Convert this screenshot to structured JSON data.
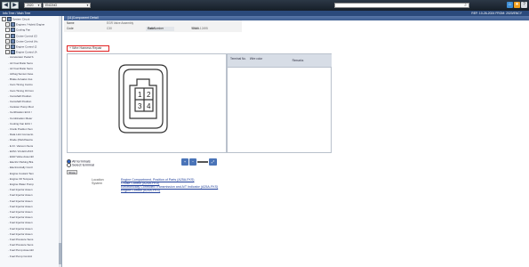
{
  "toolbar": {
    "nav_back": "◀",
    "nav_forward": "▶",
    "year": "2020",
    "model": "ENCINO",
    "search_value": "",
    "bg_color": "#1d2631"
  },
  "subbar": {
    "left": "Info Tree / Main Tree",
    "right": "REF: 10-26-2024 FROM: 2020/ENCY"
  },
  "tree": {
    "items": [
      {
        "label": "System Circuit",
        "kind": "root"
      },
      {
        "label": "Engines / Hybrid Engine",
        "kind": "folder"
      },
      {
        "label": "Cooling Fan",
        "kind": "folder"
      },
      {
        "label": "Cruise Control (Cl",
        "kind": "folder"
      },
      {
        "label": "Cruise Control (Ac",
        "kind": "folder"
      },
      {
        "label": "Engine Control (2",
        "kind": "folder"
      },
      {
        "label": "Engine Control (A",
        "kind": "folder"
      },
      {
        "label": "Accelerator Pedal S",
        "kind": "leaf"
      },
      {
        "label": "Air Fuel Ratio Sens",
        "kind": "leaf"
      },
      {
        "label": "Air Fuel Ratio Sens",
        "kind": "leaf"
      },
      {
        "label": "Airbag Sensor Asse",
        "kind": "leaf"
      },
      {
        "label": "Brake Actuator Ass",
        "kind": "leaf"
      },
      {
        "label": "Cam Timing Contro",
        "kind": "leaf"
      },
      {
        "label": "Cam Timing Oil Con",
        "kind": "leaf"
      },
      {
        "label": "Camshaft Position",
        "kind": "leaf"
      },
      {
        "label": "Camshaft Position",
        "kind": "leaf"
      },
      {
        "label": "Canister Pump Mod",
        "kind": "leaf"
      },
      {
        "label": "Certification ECU /",
        "kind": "leaf"
      },
      {
        "label": "Combination Meter",
        "kind": "leaf"
      },
      {
        "label": "Cooling Fan ECU /",
        "kind": "leaf"
      },
      {
        "label": "Crank Position Sen",
        "kind": "leaf"
      },
      {
        "label": "Data Link Connecto",
        "kind": "leaf"
      },
      {
        "label": "Diode (Park/Neutra",
        "kind": "leaf"
      },
      {
        "label": "E.F.I. Vacuum Sens",
        "kind": "leaf"
      },
      {
        "label": "ECM / HV-ECU/CIX",
        "kind": "leaf"
      },
      {
        "label": "EGR Valve Assembl",
        "kind": "leaf"
      },
      {
        "label": "Electric Parking Bra",
        "kind": "leaf"
      },
      {
        "label": "Electronically Contr",
        "kind": "leaf"
      },
      {
        "label": "Engine Coolant Tem",
        "kind": "leaf"
      },
      {
        "label": "Engine Oil Tempera",
        "kind": "leaf"
      },
      {
        "label": "Engine Water Pump",
        "kind": "leaf"
      },
      {
        "label": "Fuel Injector Assen",
        "kind": "leaf"
      },
      {
        "label": "Fuel Injector Assen",
        "kind": "leaf"
      },
      {
        "label": "Fuel Injector Assen",
        "kind": "leaf"
      },
      {
        "label": "Fuel Injector Assen",
        "kind": "leaf"
      },
      {
        "label": "Fuel Injector Assen",
        "kind": "leaf"
      },
      {
        "label": "Fuel Injector Assen",
        "kind": "leaf"
      },
      {
        "label": "Fuel Injector Assen",
        "kind": "leaf"
      },
      {
        "label": "Fuel Injector Assen",
        "kind": "leaf"
      },
      {
        "label": "Fuel Injector Assen",
        "kind": "leaf"
      },
      {
        "label": "Fuel Pressure Sens",
        "kind": "leaf"
      },
      {
        "label": "Fuel Pressure Sens",
        "kind": "leaf"
      },
      {
        "label": "Fuel Pump Assembl",
        "kind": "leaf"
      },
      {
        "label": "Fuel Pump Control",
        "kind": "leaf"
      }
    ]
  },
  "detail": {
    "title": "[11]Component Detail",
    "name_label": "Name",
    "name_value": "EGR Valve Assembly",
    "code_label": "Code",
    "code_value": "C30",
    "part_number_label": "Part Number",
    "part_number_value": "90980-12495",
    "color_label": "Color",
    "color_value": "Black",
    "wire_harness_label": "Wire Harness Repair"
  },
  "connector": {
    "pins": [
      "1",
      "2",
      "3",
      "4"
    ]
  },
  "terminal_table": {
    "headers": [
      "Terminal No.",
      "Wire color",
      "Remarks"
    ]
  },
  "terminals": {
    "all_label": "All terminals",
    "select_label": "Select terminal",
    "show_label": "Show"
  },
  "location": {
    "location_label": "Location",
    "location_value": "Engine Compartment, Position of Parts (A25A-FKS)",
    "system_label": "System",
    "systems": [
      "Cruise Control (A25A-FKS)",
      "Electronically Controlled Transmission and A/T Indicator (A25A-FKS)",
      "Engine Control (A25A-FKS)"
    ]
  }
}
